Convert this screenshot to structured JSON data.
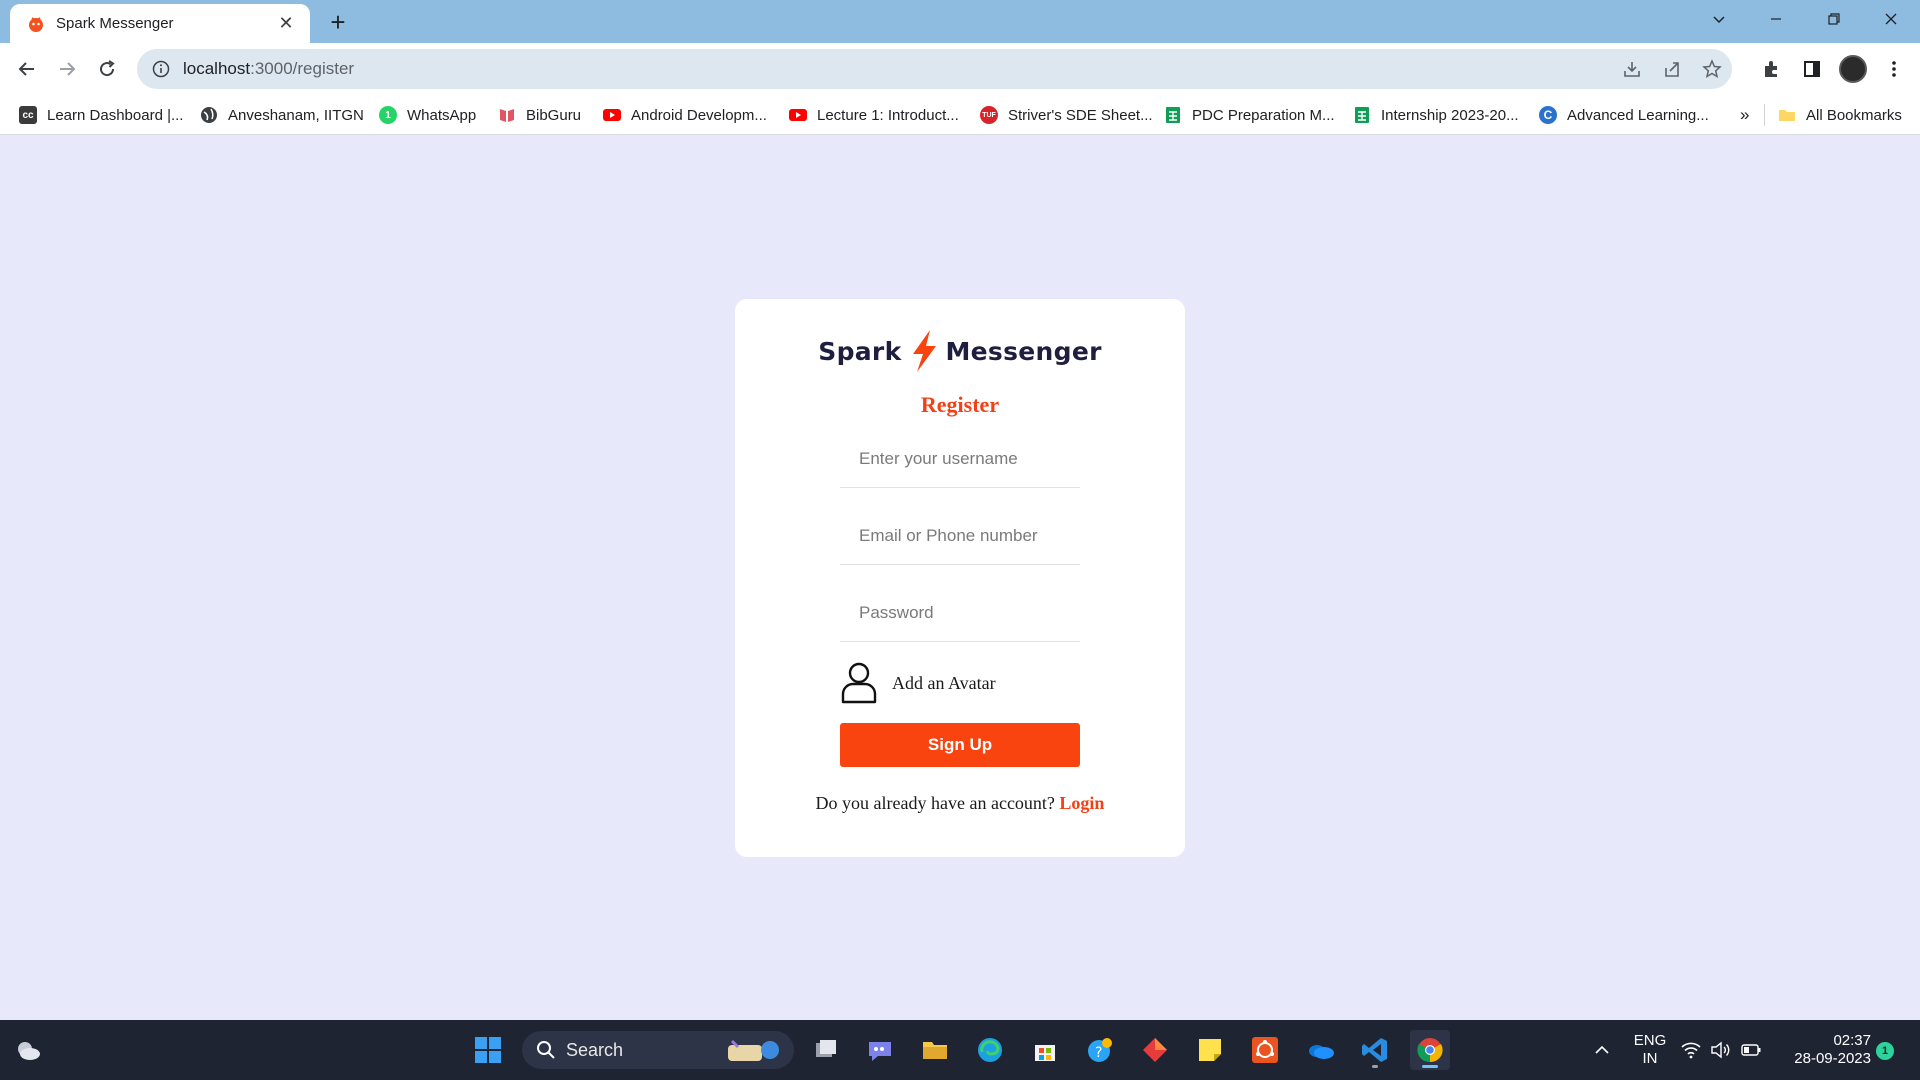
{
  "browser": {
    "tab_title": "Spark Messenger",
    "url_host": "localhost",
    "url_path": ":3000/register",
    "bookmarks": [
      {
        "label": "Learn Dashboard |...",
        "icon": "cc-icon"
      },
      {
        "label": "Anveshanam, IITGN",
        "icon": "globe-icon"
      },
      {
        "label": "WhatsApp",
        "icon": "whatsapp-icon"
      },
      {
        "label": "BibGuru",
        "icon": "bibguru-icon"
      },
      {
        "label": "Android Developm...",
        "icon": "youtube-icon"
      },
      {
        "label": "Lecture 1: Introduct...",
        "icon": "youtube-icon"
      },
      {
        "label": "Striver's SDE Sheet...",
        "icon": "tuf-icon"
      },
      {
        "label": "PDC Preparation M...",
        "icon": "sheets-icon"
      },
      {
        "label": "Internship 2023-20...",
        "icon": "sheets-icon"
      },
      {
        "label": "Advanced Learning...",
        "icon": "coursera-icon"
      }
    ],
    "bookmarks_overflow": "»",
    "all_bookmarks": "All Bookmarks"
  },
  "page": {
    "logo_left": "Spark",
    "logo_right": "Messenger",
    "heading": "Register",
    "username_placeholder": "Enter your username",
    "email_placeholder": "Email or Phone number",
    "password_placeholder": "Password",
    "avatar_label": "Add an Avatar",
    "signup_label": "Sign Up",
    "footer_prompt": "Do you already have an account? ",
    "login_label": "Login",
    "accent_color": "#f44016",
    "background_color": "#e8e8fb"
  },
  "taskbar": {
    "search_label": "Search",
    "lang_line1": "ENG",
    "lang_line2": "IN",
    "time": "02:37",
    "date": "28-09-2023",
    "notification_count": "1"
  }
}
